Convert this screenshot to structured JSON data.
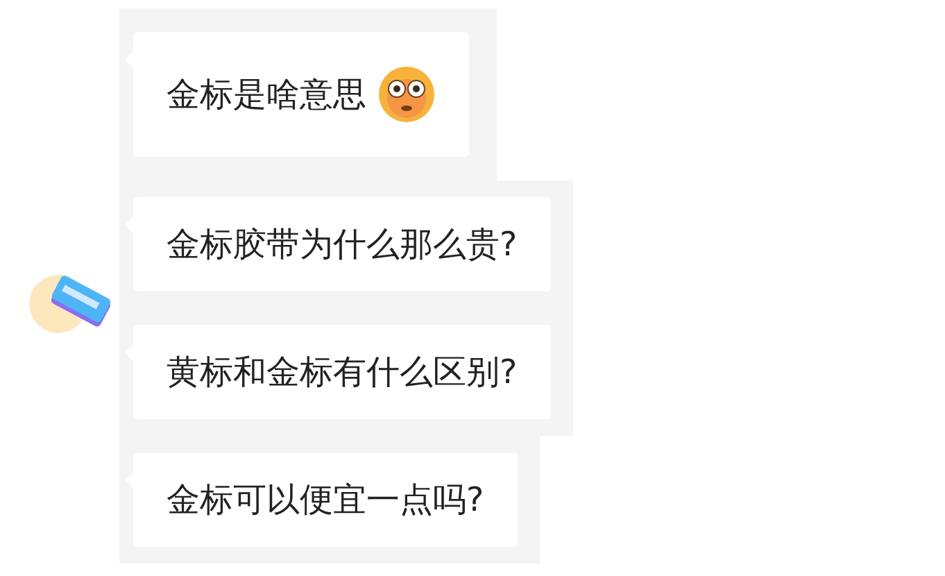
{
  "messages": [
    {
      "text": "金标是啥意思",
      "emoji": true
    },
    {
      "text": "金标胶带为什么那么贵?",
      "emoji": false
    },
    {
      "text": "黄标和金标有什么区别?",
      "emoji": false
    },
    {
      "text": "金标可以便宜一点吗?",
      "emoji": false
    }
  ]
}
